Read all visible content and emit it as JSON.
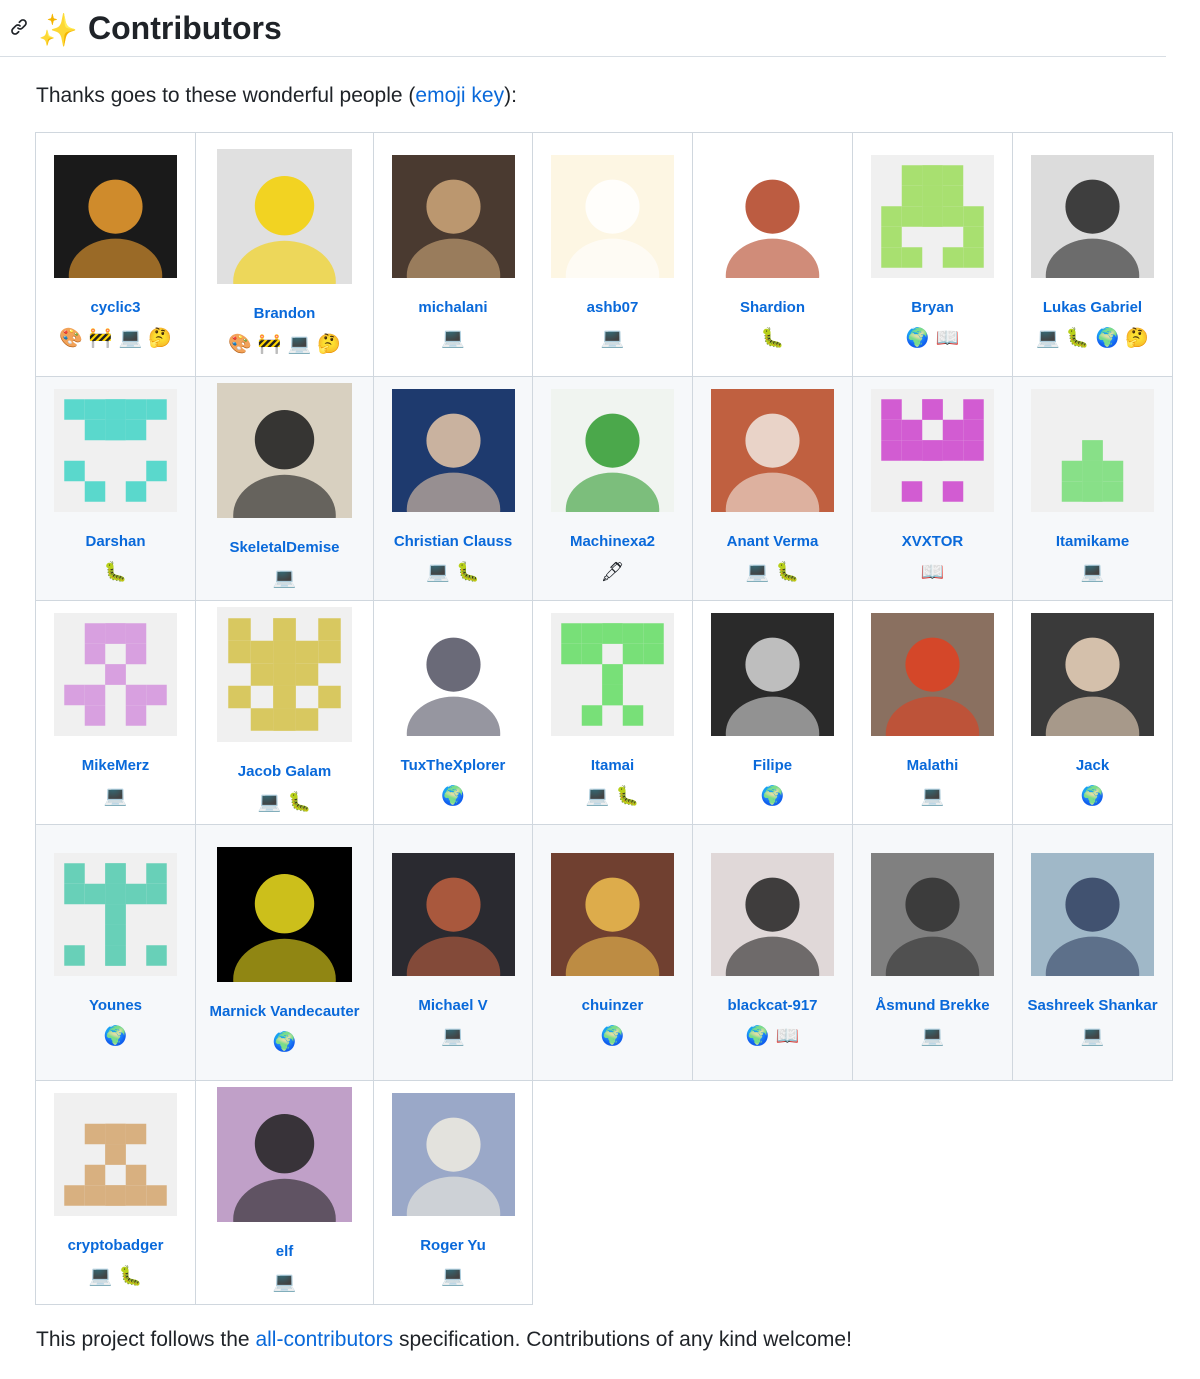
{
  "header": {
    "link_icon": "link-icon",
    "sparkles": "✨",
    "title": "Contributors"
  },
  "intro": {
    "prefix": "Thanks goes to these wonderful people (",
    "link": "emoji key",
    "suffix": "):"
  },
  "footer": {
    "prefix": "This project follows the ",
    "link": "all-contributors",
    "suffix": " specification. Contributions of any kind welcome!"
  },
  "emoji_key": {
    "design": "🎨",
    "infra": "🚧",
    "code": "💻",
    "question": "🤔",
    "bug": "🐛",
    "translation": "🌍",
    "doc": "📖",
    "content": "🖋"
  },
  "contributors": [
    [
      {
        "name": "cyclic3",
        "contribs": [
          "design",
          "infra",
          "code",
          "question"
        ],
        "avatar": "photo",
        "colors": [
          "#1a1a1a",
          "#f0a030"
        ]
      },
      {
        "name": "Brandon",
        "contribs": [
          "design",
          "infra",
          "code",
          "question"
        ],
        "avatar": "photo",
        "colors": [
          "#e0e0e0",
          "#f5d000"
        ]
      },
      {
        "name": "michalani",
        "contribs": [
          "code"
        ],
        "avatar": "photo",
        "colors": [
          "#4a3a30",
          "#cfa87a"
        ]
      },
      {
        "name": "ashb07",
        "contribs": [
          "code"
        ],
        "avatar": "photo",
        "colors": [
          "#fdf6e3",
          "#ffffff"
        ]
      },
      {
        "name": "Shardion",
        "contribs": [
          "bug"
        ],
        "avatar": "photo",
        "colors": [
          "#ffffff",
          "#b04020"
        ]
      },
      {
        "name": "Bryan",
        "contribs": [
          "translation",
          "doc"
        ],
        "avatar": "identicon",
        "colors": [
          "#f0f0f0",
          "#a8e070"
        ]
      },
      {
        "name": "Lukas Gabriel",
        "contribs": [
          "code",
          "bug",
          "translation",
          "question"
        ],
        "avatar": "photo",
        "colors": [
          "#dcdcdc",
          "#222222"
        ]
      }
    ],
    [
      {
        "name": "Darshan",
        "contribs": [
          "bug"
        ],
        "avatar": "identicon",
        "colors": [
          "#f0f0f0",
          "#5ad8cc"
        ]
      },
      {
        "name": "SkeletalDemise",
        "contribs": [
          "code"
        ],
        "avatar": "photo",
        "colors": [
          "#d8d0c0",
          "#1a1a1a"
        ]
      },
      {
        "name": "Christian Clauss",
        "contribs": [
          "code",
          "bug"
        ],
        "avatar": "photo",
        "colors": [
          "#1e3a6e",
          "#e8c8a8"
        ]
      },
      {
        "name": "Machinexa2",
        "contribs": [
          "content"
        ],
        "avatar": "photo",
        "colors": [
          "#f0f4f0",
          "#2e9a2e"
        ]
      },
      {
        "name": "Anant Verma",
        "contribs": [
          "code",
          "bug"
        ],
        "avatar": "photo",
        "colors": [
          "#c06040",
          "#f0e8e0"
        ]
      },
      {
        "name": "XVXTOR",
        "contribs": [
          "doc"
        ],
        "avatar": "identicon",
        "colors": [
          "#f0f0f0",
          "#d25cd2"
        ]
      },
      {
        "name": "Itamikame",
        "contribs": [
          "code"
        ],
        "avatar": "identicon",
        "colors": [
          "#f0f0f0",
          "#88e088"
        ]
      }
    ],
    [
      {
        "name": "MikeMerz",
        "contribs": [
          "code"
        ],
        "avatar": "identicon",
        "colors": [
          "#f0f0f0",
          "#d8a0e0"
        ]
      },
      {
        "name": "Jacob Galam",
        "contribs": [
          "code",
          "bug"
        ],
        "avatar": "identicon",
        "colors": [
          "#f0f0f0",
          "#d8c860"
        ]
      },
      {
        "name": "TuxTheXplorer",
        "contribs": [
          "translation"
        ],
        "avatar": "photo",
        "colors": [
          "#ffffff",
          "#505060"
        ]
      },
      {
        "name": "Itamai",
        "contribs": [
          "code",
          "bug"
        ],
        "avatar": "identicon",
        "colors": [
          "#f0f0f0",
          "#78e078"
        ]
      },
      {
        "name": "Filipe",
        "contribs": [
          "translation"
        ],
        "avatar": "photo",
        "colors": [
          "#2a2a2a",
          "#d8d8d8"
        ]
      },
      {
        "name": "Malathi",
        "contribs": [
          "code"
        ],
        "avatar": "photo",
        "colors": [
          "#8a7060",
          "#e04020"
        ]
      },
      {
        "name": "Jack",
        "contribs": [
          "translation"
        ],
        "avatar": "photo",
        "colors": [
          "#3a3a3a",
          "#f0d8c0"
        ]
      }
    ],
    [
      {
        "name": "Younes",
        "contribs": [
          "translation"
        ],
        "avatar": "identicon",
        "colors": [
          "#f0f0f0",
          "#68d0b8"
        ]
      },
      {
        "name": "Marnick Vandecauter",
        "contribs": [
          "translation"
        ],
        "avatar": "photo",
        "colors": [
          "#000000",
          "#f0e020"
        ]
      },
      {
        "name": "Michael V",
        "contribs": [
          "code"
        ],
        "avatar": "photo",
        "colors": [
          "#2a2a30",
          "#c06040"
        ]
      },
      {
        "name": "chuinzer",
        "contribs": [
          "translation"
        ],
        "avatar": "photo",
        "colors": [
          "#704030",
          "#f0c050"
        ]
      },
      {
        "name": "blackcat-917",
        "contribs": [
          "translation",
          "doc"
        ],
        "avatar": "photo",
        "colors": [
          "#e0d8d8",
          "#222222"
        ]
      },
      {
        "name": "Åsmund Brekke",
        "contribs": [
          "code"
        ],
        "avatar": "photo",
        "colors": [
          "#808080",
          "#303030"
        ]
      },
      {
        "name": "Sashreek Shankar",
        "contribs": [
          "code"
        ],
        "avatar": "photo",
        "colors": [
          "#a0b8c8",
          "#304060"
        ]
      }
    ],
    [
      {
        "name": "cryptobadger",
        "contribs": [
          "code",
          "bug"
        ],
        "avatar": "identicon",
        "colors": [
          "#f0f0f0",
          "#d8b080"
        ]
      },
      {
        "name": "elf",
        "contribs": [
          "code"
        ],
        "avatar": "photo",
        "colors": [
          "#c0a0c8",
          "#202020"
        ]
      },
      {
        "name": "Roger Yu",
        "contribs": [
          "code"
        ],
        "avatar": "photo",
        "colors": [
          "#9aa8c8",
          "#f0ece0"
        ]
      }
    ]
  ]
}
